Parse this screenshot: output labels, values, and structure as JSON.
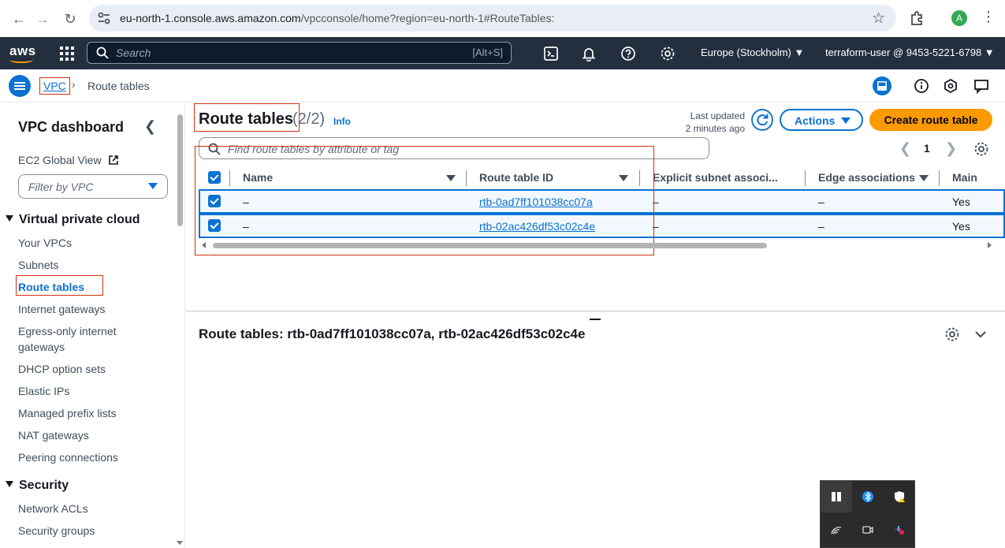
{
  "browser": {
    "url_host": "eu-north-1.console.aws.amazon.com",
    "url_path": "/vpcconsole/home?region=eu-north-1#RouteTables:",
    "profile_initial": "A"
  },
  "aws_nav": {
    "search_placeholder": "Search",
    "search_shortcut": "[Alt+S]",
    "region": "Europe (Stockholm)",
    "account": "terraform-user @ 9453-5221-6798"
  },
  "breadcrumb": {
    "root": "VPC",
    "current": "Route tables"
  },
  "sidebar": {
    "title": "VPC dashboard",
    "ec2_global_view": "EC2 Global View",
    "filter_placeholder": "Filter by VPC",
    "section_vpc": "Virtual private cloud",
    "vpc_items": [
      "Your VPCs",
      "Subnets",
      "Route tables",
      "Internet gateways",
      "Egress-only internet",
      "gateways",
      "DHCP option sets",
      "Elastic IPs",
      "Managed prefix lists",
      "NAT gateways",
      "Peering connections"
    ],
    "section_security": "Security",
    "security_items": [
      "Network ACLs",
      "Security groups"
    ]
  },
  "main": {
    "title": "Route tables",
    "count": "(2/2)",
    "info": "Info",
    "last_updated_label": "Last updated",
    "last_updated_value": "2 minutes ago",
    "actions_label": "Actions",
    "create_label": "Create route table",
    "search_placeholder": "Find route tables by attribute or tag",
    "page_number": "1",
    "columns": [
      "Name",
      "Route table ID",
      "Explicit subnet associ...",
      "Edge associations",
      "Main"
    ],
    "rows": [
      {
        "name": "–",
        "id": "rtb-0ad7ff101038cc07a",
        "explicit": "–",
        "edge": "–",
        "main": "Yes"
      },
      {
        "name": "–",
        "id": "rtb-02ac426df53c02c4e",
        "explicit": "–",
        "edge": "–",
        "main": "Yes"
      }
    ],
    "detail_title": "Route tables: rtb-0ad7ff101038cc07a, rtb-02ac426df53c02c4e"
  },
  "colors": {
    "accent": "#0972d3",
    "primary_button": "#ff9900",
    "nav_bg": "#232f3e",
    "highlight_border": "#d13212"
  }
}
